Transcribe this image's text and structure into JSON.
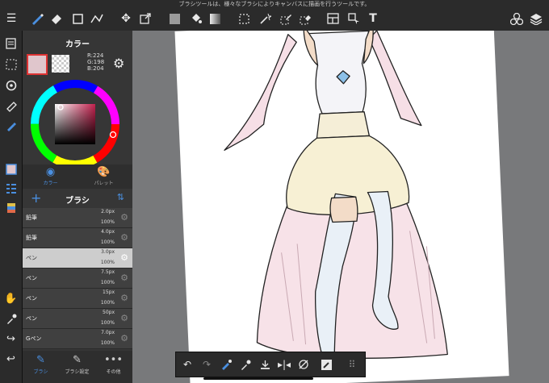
{
  "tooltip": "ブラシツールは、様々なブラシによりキャンバスに描画を行うツールです。",
  "color_panel": {
    "title": "カラー",
    "rgb_r": "R:224",
    "rgb_g": "G:198",
    "rgb_b": "B:204",
    "current_color": "#e0c6cc",
    "tab_color": "カラー",
    "tab_palette": "パレット"
  },
  "brush_panel": {
    "title": "ブラシ",
    "brushes": [
      {
        "name": "鉛筆",
        "size": "2.0px",
        "opacity": "100%"
      },
      {
        "name": "鉛筆",
        "size": "4.0px",
        "opacity": "100%"
      },
      {
        "name": "ペン",
        "size": "3.0px",
        "opacity": "100%"
      },
      {
        "name": "ペン",
        "size": "7.5px",
        "opacity": "100%"
      },
      {
        "name": "ペン",
        "size": "15px",
        "opacity": "100%"
      },
      {
        "name": "ペン",
        "size": "50px",
        "opacity": "100%"
      },
      {
        "name": "Gペン",
        "size": "7.0px",
        "opacity": "100%"
      }
    ]
  },
  "bottom_tabs": {
    "brush": "ブラシ",
    "brush_settings": "ブラシ設定",
    "other": "その他"
  },
  "colors": {
    "accent": "#4a8fe0",
    "panel": "#363636",
    "toolbar": "#2b2b2b",
    "canvas_bg": "#78797b"
  }
}
